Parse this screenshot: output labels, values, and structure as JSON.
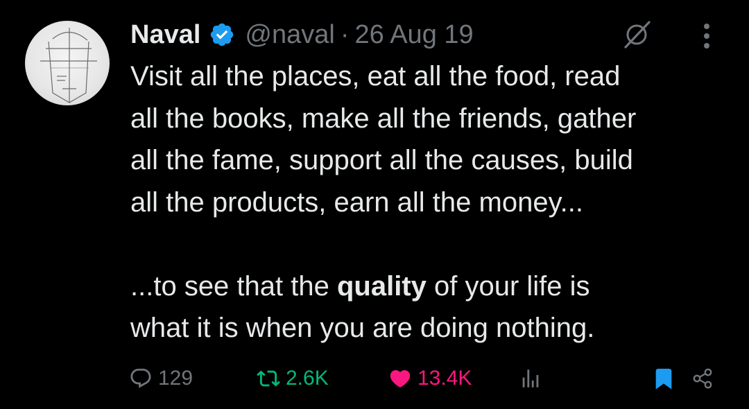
{
  "author": {
    "display_name": "Naval",
    "handle": "@naval",
    "separator": "·",
    "date": "26 Aug 19",
    "verified": true,
    "avatar_icon": "sketched-face-avatar"
  },
  "header_icons": {
    "grok": "grok-slash-circle-icon",
    "more": "more-vertical-dots-icon"
  },
  "tweet": {
    "line1": "Visit all the places, eat all the food, read",
    "line2": "all the books, make all the friends, gather",
    "line3": "all the fame, support all the causes, build",
    "line4": "all the products, earn all the money...",
    "line5_before": "...to see that the ",
    "line5_bold": "quality",
    "line5_after": " of your life is",
    "line6": "what it is when you are doing nothing."
  },
  "actions": {
    "reply_count": "129",
    "retweet_count": "2.6K",
    "like_count": "13.4K",
    "bookmarked": true,
    "liked": true
  },
  "colors": {
    "background": "#000000",
    "text": "#e7e9ea",
    "muted": "#71767b",
    "verified_blue": "#1d9bf0",
    "retweet_green": "#00ba7c",
    "like_pink": "#f91880",
    "bookmark_blue": "#1d9bf0"
  }
}
